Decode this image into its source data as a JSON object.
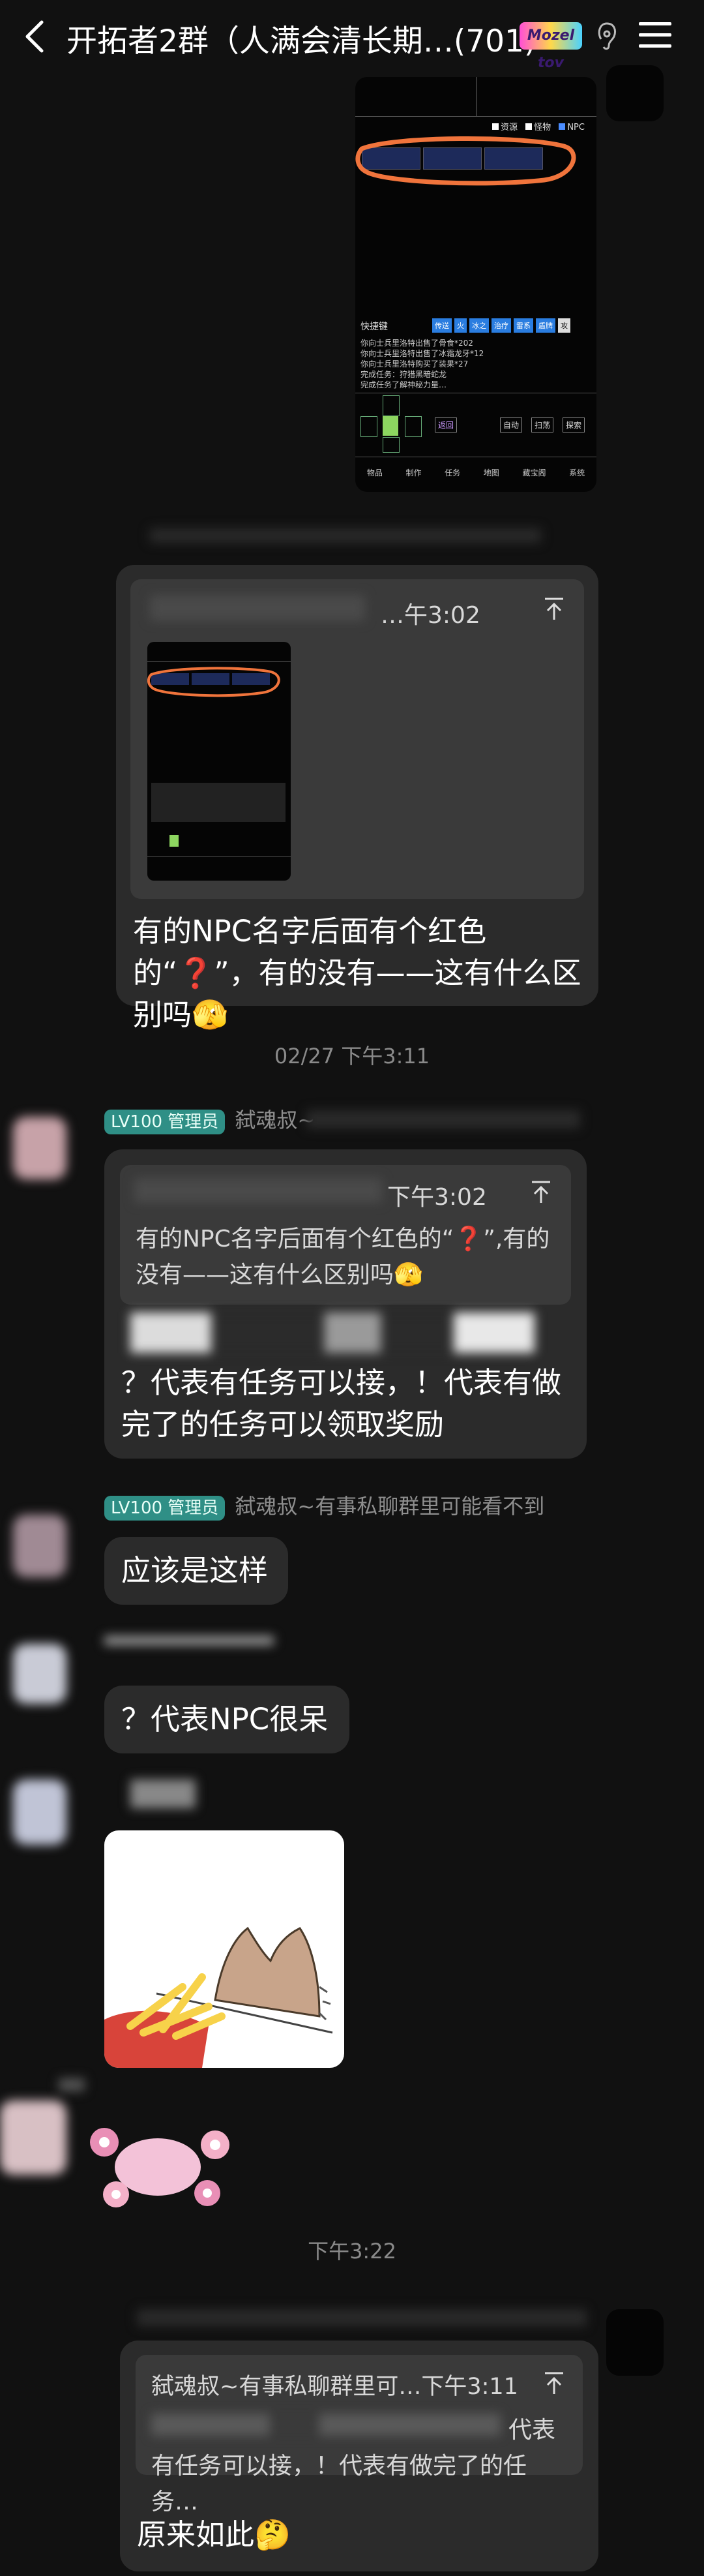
{
  "header": {
    "title": "开拓者2群（人满会清长期…(701)",
    "back_icon": "chevron-left-icon",
    "sticker_text": "Mozel tov",
    "ear_icon": "ear-icon",
    "menu_icon": "menu-icon"
  },
  "screenshot1": {
    "filters": [
      "资源",
      "怪物",
      "NPC"
    ],
    "shortcut_label": "快捷键",
    "shortcut_buttons": [
      "传送",
      "火",
      "冰之",
      "治疗",
      "雷系",
      "盾牌",
      "攻"
    ],
    "log_lines": [
      "你向士兵里洛特出售了骨食*202",
      "你向士兵里洛特出售了冰霜龙牙*12",
      "你向士兵里洛特购买了装果*27",
      "完成任务：狩猎黑暗蛇龙",
      "完成任务了解神秘力量…"
    ],
    "action_buttons": [
      "返回",
      "自动",
      "扫荡",
      "探索"
    ],
    "bottom_tabs": [
      "物品",
      "制作",
      "任务",
      "地图",
      "藏宝阁",
      "系统"
    ]
  },
  "msg1": {
    "quote_time": "…午3:02",
    "text": "有的NPC名字后面有个红色的“❓”，有的没有——这有什么区别吗🫣"
  },
  "sep1": "02/27 下午3:11",
  "msg2": {
    "badge": "LV100 管理员",
    "sender": "弑魂叔~",
    "quote_time": "下午3:02",
    "quote_text": "有的NPC名字后面有个红色的“❓”,有的没有——这有什么区别吗🫣",
    "text": "？代表有任务可以接，！代表有做完了的任务可以领取奖励"
  },
  "msg3": {
    "badge": "LV100 管理员",
    "sender": "弑魂叔~有事私聊群里可能看不到",
    "text": "应该是这样"
  },
  "msg4": {
    "text": "？代表NPC很呆"
  },
  "sep2": "下午3:22",
  "msg5": {
    "quote_header": "弑魂叔~有事私聊群里可…下午3:11",
    "quote_text": "代表有任务可以接，！代表有做完了的任务…",
    "text": "原来如此🤔"
  },
  "colors": {
    "background": "#111111",
    "bubble": "#2b2b2b",
    "quote": "#3a3a3a",
    "badge": "#2f8f86",
    "annotation": "#f0743c"
  }
}
